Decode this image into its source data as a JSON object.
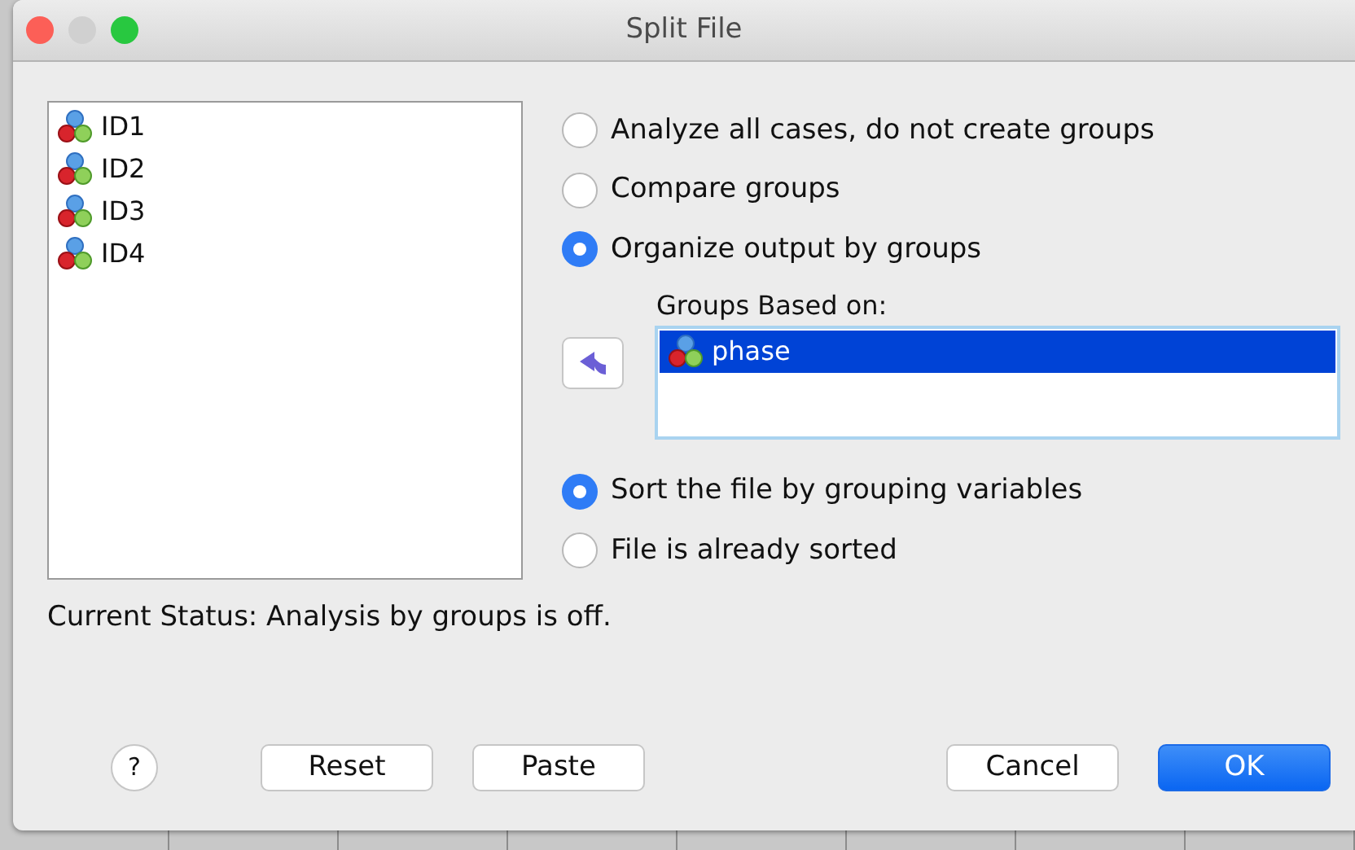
{
  "window": {
    "title": "Split File"
  },
  "source_list": {
    "items": [
      {
        "label": "ID1"
      },
      {
        "label": "ID2"
      },
      {
        "label": "ID3"
      },
      {
        "label": "ID4"
      }
    ]
  },
  "group_options": [
    {
      "label": "Analyze all cases, do not create groups",
      "selected": false
    },
    {
      "label": "Compare groups",
      "selected": false
    },
    {
      "label": "Organize output by groups",
      "selected": true
    }
  ],
  "groups_based_on": {
    "label": "Groups Based on:",
    "items": [
      {
        "label": "phase",
        "selected": true
      }
    ]
  },
  "sort_options": [
    {
      "label": "Sort the file by grouping variables",
      "selected": true
    },
    {
      "label": "File is already sorted",
      "selected": false
    }
  ],
  "status": "Current Status: Analysis by groups is off.",
  "buttons": [
    {
      "label": "?",
      "kind": "help"
    },
    {
      "label": "Reset",
      "kind": "plain"
    },
    {
      "label": "Paste",
      "kind": "plain"
    },
    {
      "label": "Cancel",
      "kind": "plain"
    },
    {
      "label": "OK",
      "kind": "primary"
    }
  ]
}
